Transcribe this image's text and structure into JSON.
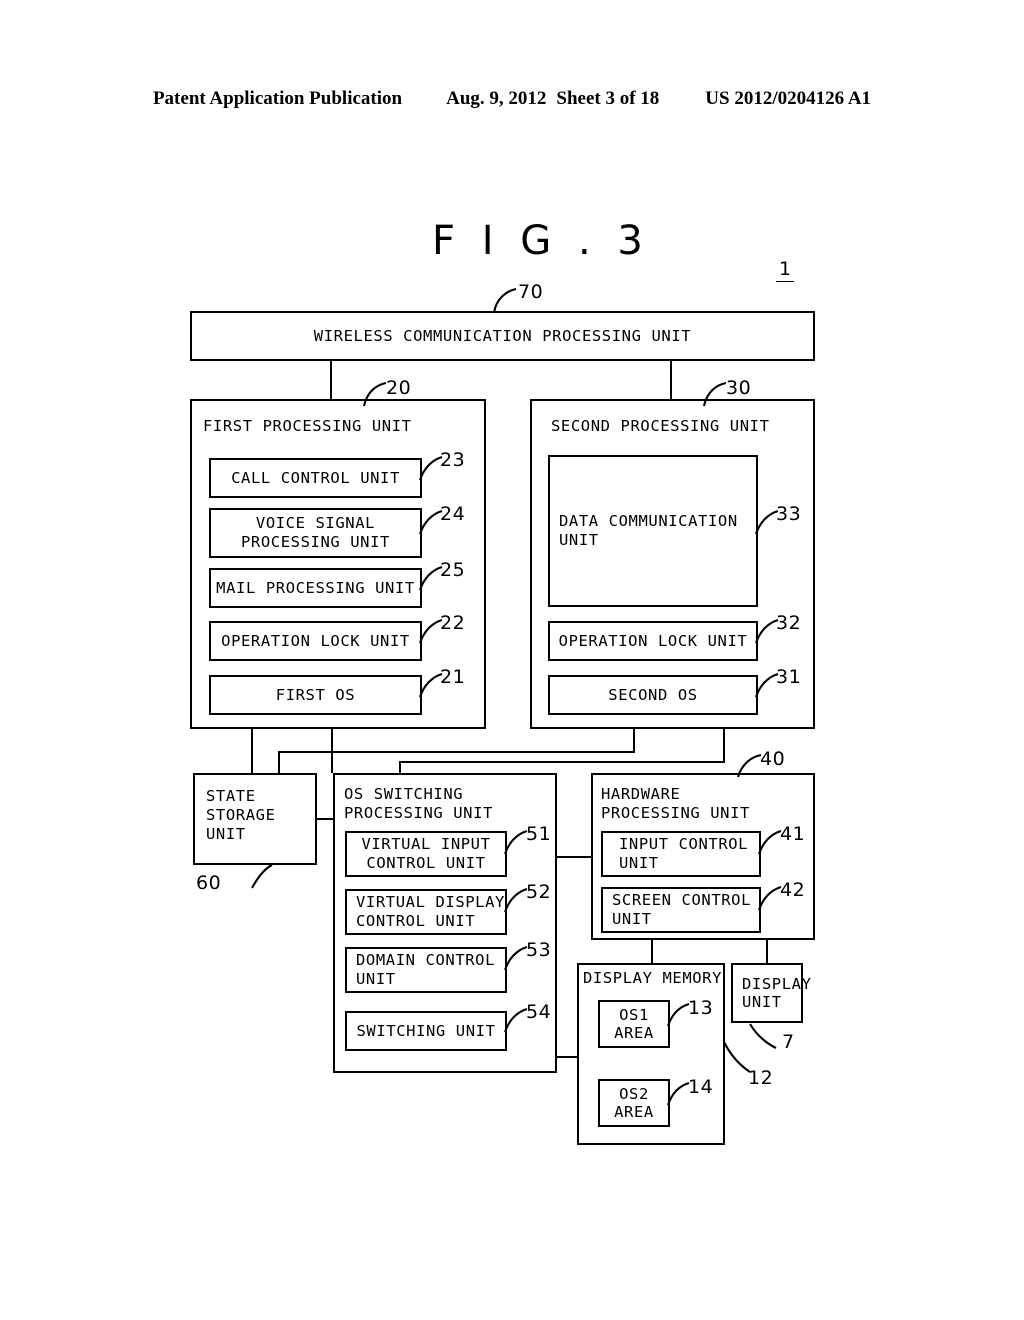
{
  "header": {
    "publication": "Patent Application Publication",
    "date": "Aug. 9, 2012",
    "sheet": "Sheet 3 of 18",
    "patent_number": "US 2012/0204126 A1"
  },
  "figure": {
    "title": "F I G . 3",
    "assembly_ref": "1"
  },
  "blocks": {
    "wireless": {
      "label": "WIRELESS COMMUNICATION PROCESSING UNIT",
      "ref": "70"
    },
    "first_processing": {
      "label": "FIRST PROCESSING UNIT",
      "ref": "20"
    },
    "second_processing": {
      "label": "SECOND PROCESSING UNIT",
      "ref": "30"
    },
    "call_control": {
      "label": "CALL CONTROL UNIT",
      "ref": "23"
    },
    "voice_signal": {
      "label": "VOICE SIGNAL\nPROCESSING UNIT",
      "ref": "24"
    },
    "mail_processing": {
      "label": "MAIL PROCESSING UNIT",
      "ref": "25"
    },
    "operation_lock_1": {
      "label": "OPERATION LOCK UNIT",
      "ref": "22"
    },
    "first_os": {
      "label": "FIRST OS",
      "ref": "21"
    },
    "data_communication": {
      "label": "DATA COMMUNICATION\nUNIT",
      "ref": "33"
    },
    "operation_lock_2": {
      "label": "OPERATION LOCK UNIT",
      "ref": "32"
    },
    "second_os": {
      "label": "SECOND OS",
      "ref": "31"
    },
    "state_storage": {
      "label": "STATE\nSTORAGE\nUNIT",
      "ref": "60"
    },
    "os_switching": {
      "label": "OS SWITCHING\nPROCESSING UNIT"
    },
    "virtual_input": {
      "label": "VIRTUAL INPUT\nCONTROL UNIT",
      "ref": "51"
    },
    "virtual_display": {
      "label": "VIRTUAL DISPLAY\nCONTROL UNIT",
      "ref": "52"
    },
    "domain_control": {
      "label": "DOMAIN CONTROL\nUNIT",
      "ref": "53"
    },
    "switching_unit": {
      "label": "SWITCHING UNIT",
      "ref": "54"
    },
    "hardware_processing": {
      "label": "HARDWARE\nPROCESSING UNIT",
      "ref": "40"
    },
    "input_control": {
      "label": "INPUT CONTROL\nUNIT",
      "ref": "41"
    },
    "screen_control": {
      "label": "SCREEN CONTROL\nUNIT",
      "ref": "42"
    },
    "display_memory": {
      "label": "DISPLAY MEMORY",
      "ref": "12"
    },
    "os1_area": {
      "label": "OS1\nAREA",
      "ref": "13"
    },
    "os2_area": {
      "label": "OS2\nAREA",
      "ref": "14"
    },
    "display_unit": {
      "label": "DISPLAY\nUNIT",
      "ref": "7"
    }
  }
}
